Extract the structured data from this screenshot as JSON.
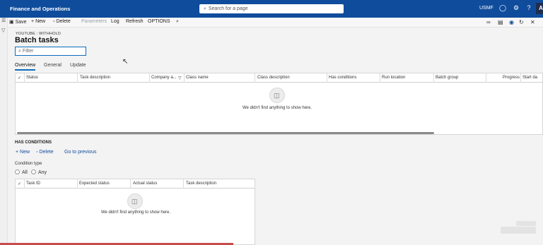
{
  "topbar": {
    "app_name": "Finance and Operations",
    "search_placeholder": "Search for a page",
    "company": "USMF",
    "avatar_initial": "A"
  },
  "actions": {
    "save": "Save",
    "new": "New",
    "delete": "Delete",
    "parameters": "Parameters",
    "log": "Log",
    "refresh": "Refresh",
    "options": "OPTIONS"
  },
  "page": {
    "breadcrumb": "YOUTUBE : WITHHOLD",
    "title": "Batch tasks",
    "filter_placeholder": "Filter"
  },
  "tabs": [
    {
      "label": "Overview",
      "active": true
    },
    {
      "label": "General",
      "active": false
    },
    {
      "label": "Update",
      "active": false
    }
  ],
  "tasks_grid": {
    "columns": [
      "Status",
      "Task description",
      "Company a...",
      "Class name",
      "Class description",
      "Has conditions",
      "Run location",
      "Batch group",
      "Progress",
      "Start da"
    ],
    "empty_message": "We didn't find anything to show here."
  },
  "conditions": {
    "section_title": "HAS CONDITIONS",
    "new": "New",
    "delete": "Delete",
    "go_previous": "Go to previous",
    "condition_type_label": "Condition type",
    "options": [
      "All",
      "Any"
    ],
    "columns": [
      "Task ID",
      "Expected status",
      "Actual status",
      "Task description"
    ],
    "empty_message": "We didn't find anything to show here."
  },
  "colors": {
    "nav_bar": "#0f4c9c",
    "accent": "#0f6cbd"
  }
}
